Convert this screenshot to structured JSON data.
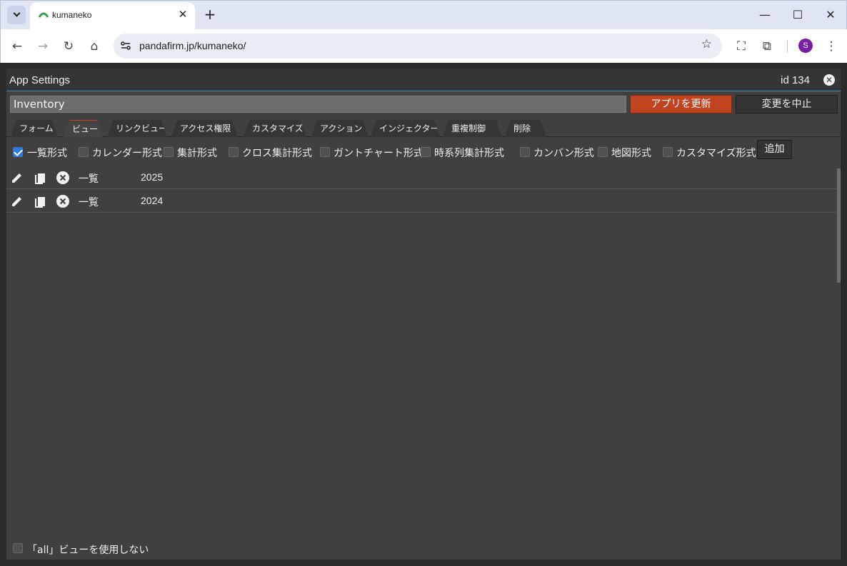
{
  "browser": {
    "tab_title": "kumaneko",
    "url": "pandafirm.jp/kumaneko/",
    "profile_initial": "S"
  },
  "modal": {
    "title": "App Settings",
    "id_label": "id 134",
    "app_name_value": "Inventory",
    "update_button": "アプリを更新",
    "cancel_button": "変更を中止",
    "tabs": [
      "フォーム",
      "ビュー",
      "リンクビュー",
      "アクセス権限",
      "カスタマイズ",
      "アクション",
      "インジェクター",
      "重複制御",
      "削除"
    ],
    "active_tab": "ビュー",
    "view_types": [
      {
        "label": "一覧形式",
        "checked": true
      },
      {
        "label": "カレンダー形式",
        "checked": false
      },
      {
        "label": "集計形式",
        "checked": false
      },
      {
        "label": "クロス集計形式",
        "checked": false
      },
      {
        "label": "ガントチャート形式",
        "checked": false
      },
      {
        "label": "時系列集計形式",
        "checked": false
      },
      {
        "label": "カンバン形式",
        "checked": false
      },
      {
        "label": "地図形式",
        "checked": false
      },
      {
        "label": "カスタマイズ形式",
        "checked": false
      }
    ],
    "add_button": "追加",
    "views": [
      {
        "type": "一覧",
        "name": "2025"
      },
      {
        "type": "一覧",
        "name": "2024"
      }
    ],
    "footer_option": {
      "label": "「all」ビューを使用しない",
      "checked": false
    }
  },
  "colors": {
    "accent": "#c0441f",
    "checkbox_checked": "#2f7ad8",
    "modal_bg": "#404040",
    "header_line": "#3f8fc4"
  }
}
